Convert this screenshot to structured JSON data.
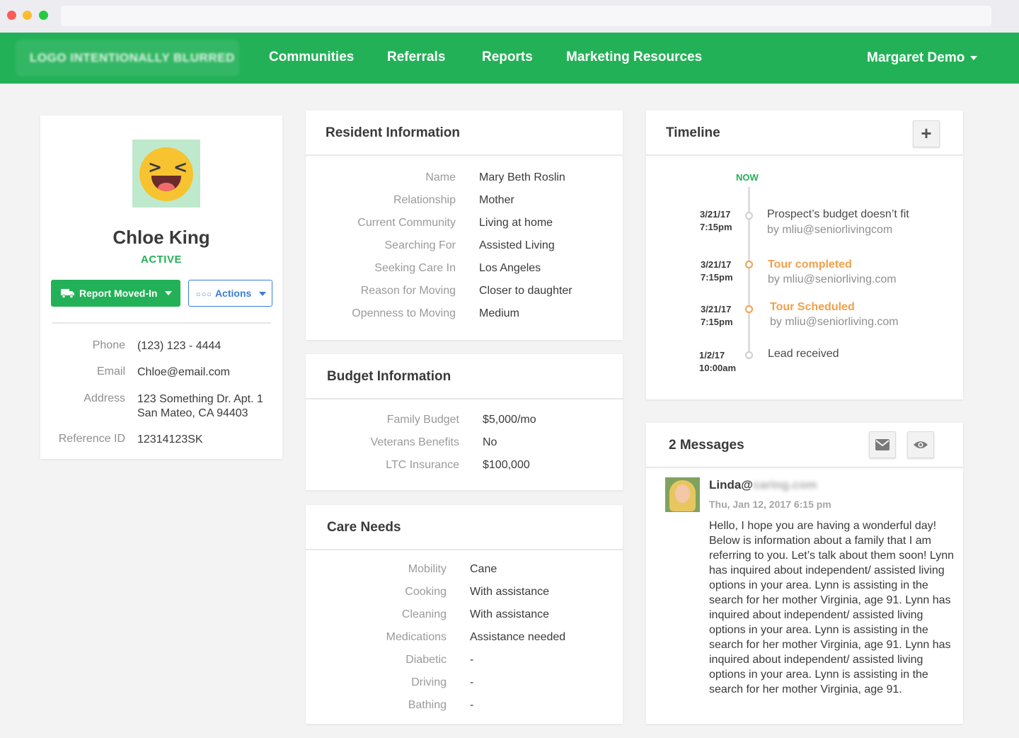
{
  "nav": {
    "logo": "LOGO INTENTIONALLY BLURRED",
    "links": [
      "Communities",
      "Referrals",
      "Reports",
      "Marketing Resources"
    ],
    "user": "Margaret Demo"
  },
  "profile": {
    "name": "Chloe King",
    "status": "ACTIVE",
    "report_button": "Report Moved-In",
    "actions_button": "Actions",
    "phone_label": "Phone",
    "phone": "(123) 123 - 4444",
    "email_label": "Email",
    "email": "Chloe@email.com",
    "address_label": "Address",
    "address_line1": "123 Something Dr. Apt. 1",
    "address_line2": "San Mateo, CA 94403",
    "ref_label": "Reference ID",
    "ref": "12314123SK"
  },
  "resident": {
    "title": "Resident Information",
    "rows": [
      {
        "label": "Name",
        "value": "Mary Beth Roslin"
      },
      {
        "label": "Relationship",
        "value": "Mother"
      },
      {
        "label": "Current Community",
        "value": "Living at home"
      },
      {
        "label": "Searching For",
        "value": "Assisted Living"
      },
      {
        "label": "Seeking Care In",
        "value": "Los Angeles"
      },
      {
        "label": "Reason for Moving",
        "value": "Closer to daughter"
      },
      {
        "label": "Openness to Moving",
        "value": "Medium"
      }
    ]
  },
  "budget": {
    "title": "Budget Information",
    "rows": [
      {
        "label": "Family Budget",
        "value": "$5,000/mo"
      },
      {
        "label": "Veterans Benefits",
        "value": "No"
      },
      {
        "label": "LTC Insurance",
        "value": "$100,000"
      }
    ]
  },
  "care": {
    "title": "Care Needs",
    "rows": [
      {
        "label": "Mobility",
        "value": "Cane"
      },
      {
        "label": "Cooking",
        "value": "With assistance"
      },
      {
        "label": "Cleaning",
        "value": "With assistance"
      },
      {
        "label": "Medications",
        "value": "Assistance needed"
      },
      {
        "label": "Diabetic",
        "value": "-"
      },
      {
        "label": "Driving",
        "value": "-"
      },
      {
        "label": "Bathing",
        "value": "-"
      }
    ]
  },
  "timeline": {
    "title": "Timeline",
    "now": "NOW",
    "events": [
      {
        "date": "3/21/17",
        "time": "7:15pm",
        "title": "Prospect’s budget doesn’t fit",
        "by": "by mliu@seniorlivingcom",
        "highlight": false
      },
      {
        "date": "3/21/17",
        "time": "7:15pm",
        "title": "Tour completed",
        "by": "by mliu@seniorliving.com",
        "highlight": true
      },
      {
        "date": "3/21/17",
        "time": "7:15pm",
        "title": "Tour Scheduled",
        "by": "by mliu@seniorliving.com",
        "highlight": true
      },
      {
        "date": "1/2/17",
        "time": "10:00am",
        "title": "Lead received",
        "by": "",
        "highlight": false
      }
    ]
  },
  "messages": {
    "title": "2 Messages",
    "from_visible": "Linda@",
    "from_blurred": "caring.com",
    "date": "Thu, Jan 12, 2017 6:15 pm",
    "body": "Hello, I hope you are having a wonderful day! Below is information about a family that I am referring to you. Let’s talk about them soon!  Lynn has inquired about independent/ assisted living options in your area. Lynn is assisting in the search for her mother Virginia, age 91. Lynn has inquired about independent/ assisted living options in your area. Lynn is assisting in the search for her mother Virginia, age 91. Lynn has inquired about independent/ assisted living options in your area. Lynn is assisting in the search for her mother Virginia, age 91."
  },
  "colors": {
    "brand_green": "#23b157",
    "accent_blue": "#3b7dd8",
    "timeline_orange": "#f0a04b"
  }
}
